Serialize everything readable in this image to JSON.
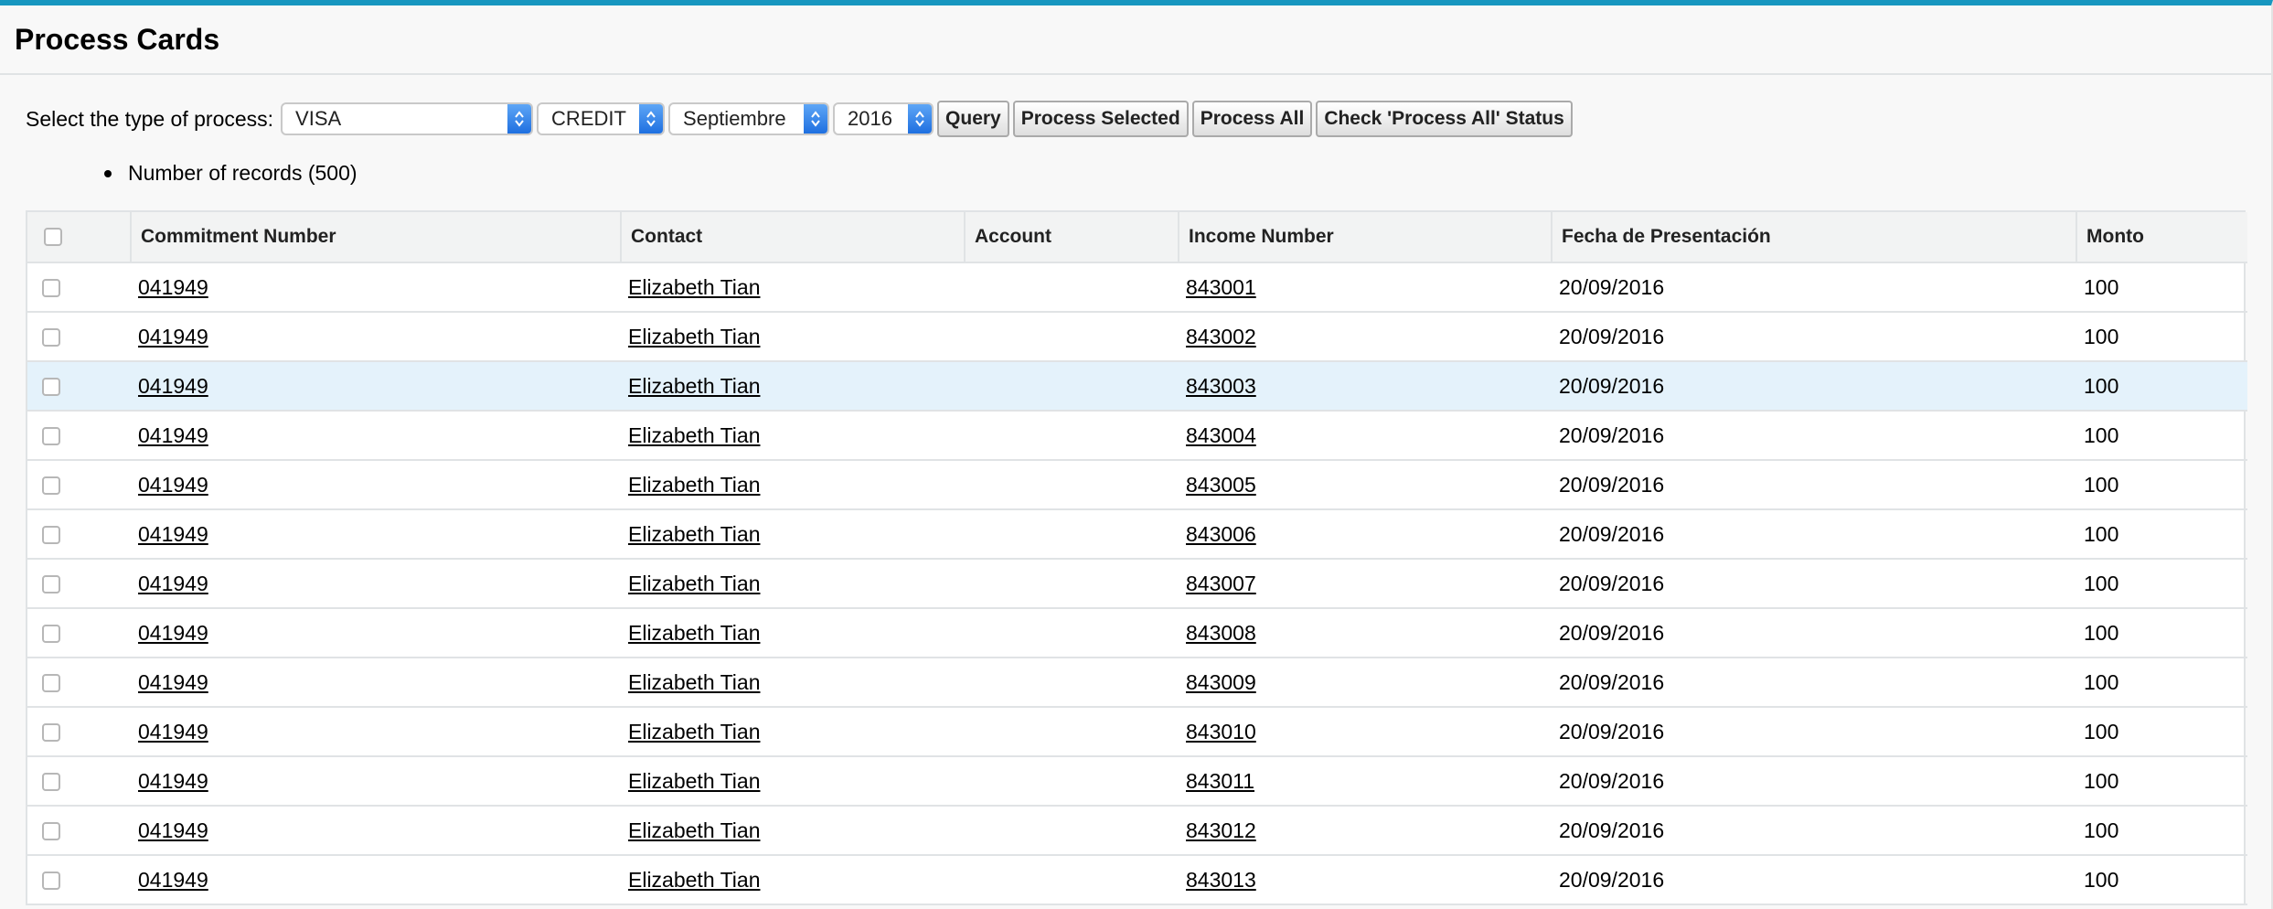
{
  "page": {
    "title": "Process Cards"
  },
  "filters": {
    "label": "Select the type of process:",
    "card_type": "VISA",
    "transaction_type": "CREDIT",
    "month": "Septiembre",
    "year": "2016"
  },
  "buttons": {
    "query": "Query",
    "process_selected": "Process Selected",
    "process_all": "Process All",
    "check_status": "Check 'Process All' Status"
  },
  "records_label": "Number of records (500)",
  "table": {
    "columns": [
      "Commitment Number",
      "Contact",
      "Account",
      "Income Number",
      "Fecha de Presentación",
      "Monto"
    ],
    "rows": [
      {
        "commitment": "041949",
        "contact": "Elizabeth Tian",
        "account": "",
        "income": "843001",
        "fecha": "20/09/2016",
        "monto": "100"
      },
      {
        "commitment": "041949",
        "contact": "Elizabeth Tian",
        "account": "",
        "income": "843002",
        "fecha": "20/09/2016",
        "monto": "100"
      },
      {
        "commitment": "041949",
        "contact": "Elizabeth Tian",
        "account": "",
        "income": "843003",
        "fecha": "20/09/2016",
        "monto": "100"
      },
      {
        "commitment": "041949",
        "contact": "Elizabeth Tian",
        "account": "",
        "income": "843004",
        "fecha": "20/09/2016",
        "monto": "100"
      },
      {
        "commitment": "041949",
        "contact": "Elizabeth Tian",
        "account": "",
        "income": "843005",
        "fecha": "20/09/2016",
        "monto": "100"
      },
      {
        "commitment": "041949",
        "contact": "Elizabeth Tian",
        "account": "",
        "income": "843006",
        "fecha": "20/09/2016",
        "monto": "100"
      },
      {
        "commitment": "041949",
        "contact": "Elizabeth Tian",
        "account": "",
        "income": "843007",
        "fecha": "20/09/2016",
        "monto": "100"
      },
      {
        "commitment": "041949",
        "contact": "Elizabeth Tian",
        "account": "",
        "income": "843008",
        "fecha": "20/09/2016",
        "monto": "100"
      },
      {
        "commitment": "041949",
        "contact": "Elizabeth Tian",
        "account": "",
        "income": "843009",
        "fecha": "20/09/2016",
        "monto": "100"
      },
      {
        "commitment": "041949",
        "contact": "Elizabeth Tian",
        "account": "",
        "income": "843010",
        "fecha": "20/09/2016",
        "monto": "100"
      },
      {
        "commitment": "041949",
        "contact": "Elizabeth Tian",
        "account": "",
        "income": "843011",
        "fecha": "20/09/2016",
        "monto": "100"
      },
      {
        "commitment": "041949",
        "contact": "Elizabeth Tian",
        "account": "",
        "income": "843012",
        "fecha": "20/09/2016",
        "monto": "100"
      },
      {
        "commitment": "041949",
        "contact": "Elizabeth Tian",
        "account": "",
        "income": "843013",
        "fecha": "20/09/2016",
        "monto": "100"
      }
    ]
  },
  "colors": {
    "accent": "#1797c0",
    "row_highlight": "#e4f2fb",
    "select_arrow": "#1e6fe0"
  }
}
